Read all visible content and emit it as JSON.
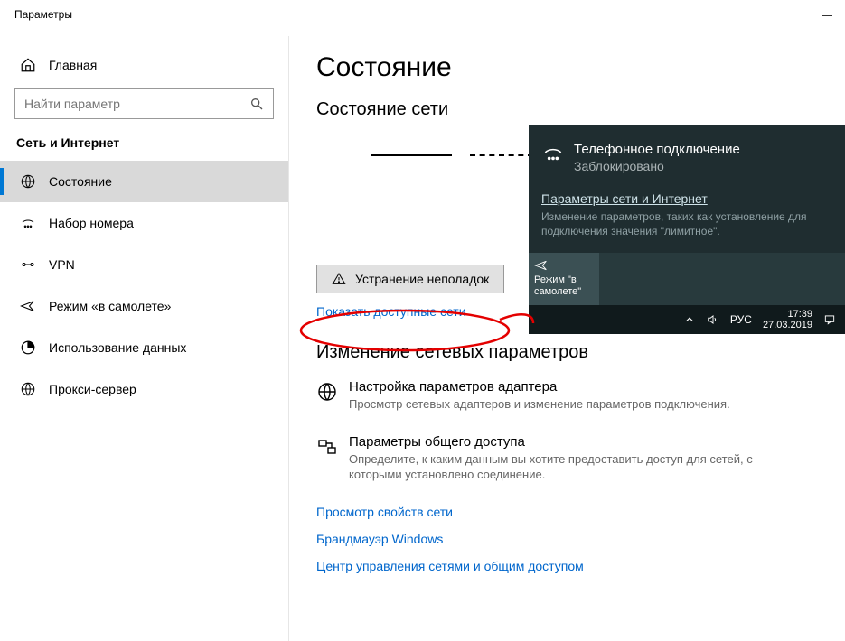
{
  "window_title": "Параметры",
  "sidebar": {
    "home": "Главная",
    "search_placeholder": "Найти параметр",
    "section": "Сеть и Интернет",
    "items": [
      {
        "label": "Состояние"
      },
      {
        "label": "Набор номера"
      },
      {
        "label": "VPN"
      },
      {
        "label": "Режим «в самолете»"
      },
      {
        "label": "Использование данных"
      },
      {
        "label": "Прокси-сервер"
      }
    ]
  },
  "content": {
    "page_title": "Состояние",
    "subtitle": "Состояние сети",
    "troubleshoot_label": "Устранение неполадок",
    "show_networks_link": "Показать доступные сети",
    "change_settings_heading": "Изменение сетевых параметров",
    "adapter": {
      "title": "Настройка параметров адаптера",
      "desc": "Просмотр сетевых адаптеров и изменение параметров подключения."
    },
    "sharing": {
      "title": "Параметры общего доступа",
      "desc": "Определите, к каким данным вы хотите предоставить доступ для сетей, с которыми установлено соединение."
    },
    "links": {
      "props": "Просмотр свойств сети",
      "firewall": "Брандмауэр Windows",
      "sharing_center": "Центр управления сетями и общим доступом"
    }
  },
  "flyout": {
    "conn_title": "Телефонное подключение",
    "conn_status": "Заблокировано",
    "settings_link": "Параметры сети и Интернет",
    "settings_desc": "Изменение параметров, таких как установление для подключения значения \"лимитное\".",
    "tile_airplane": "Режим \"в самолете\""
  },
  "taskbar": {
    "lang": "РУС",
    "time": "17:39",
    "date": "27.03.2019"
  }
}
